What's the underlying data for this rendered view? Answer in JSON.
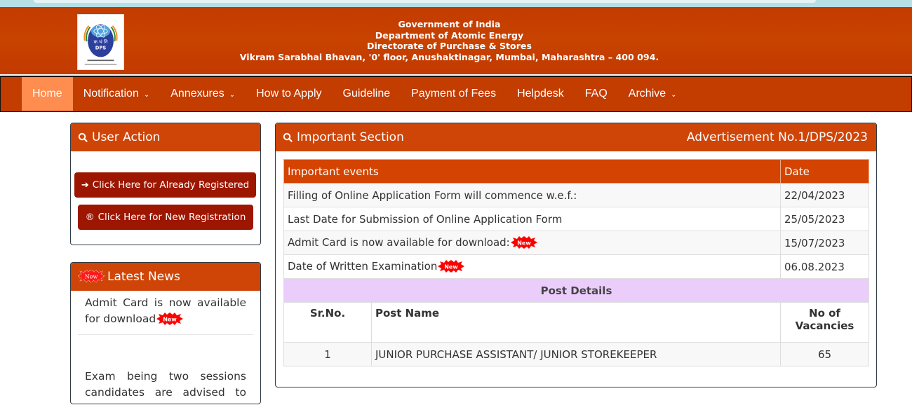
{
  "header": {
    "lines": [
      "Government of India",
      "Department of Atomic Energy",
      "Directorate of Purchase & Stores",
      "Vikram Sarabhai Bhavan, '0' floor, Anushaktinagar, Mumbai, Maharashtra – 400 094."
    ],
    "logo": {
      "text_top": "क भं नि",
      "text_bottom": "DPS"
    }
  },
  "nav": {
    "items": [
      {
        "label": "Home",
        "active": true,
        "dropdown": false
      },
      {
        "label": "Notification",
        "dropdown": true
      },
      {
        "label": "Annexures",
        "dropdown": true
      },
      {
        "label": "How to Apply",
        "dropdown": false
      },
      {
        "label": "Guideline",
        "dropdown": false
      },
      {
        "label": "Payment of Fees",
        "dropdown": false
      },
      {
        "label": "Helpdesk",
        "dropdown": false
      },
      {
        "label": "FAQ",
        "dropdown": false
      },
      {
        "label": "Archive",
        "dropdown": true
      }
    ],
    "chevron": "⌄"
  },
  "user_action": {
    "title": "User Action",
    "buttons": {
      "registered": {
        "icon": "➔",
        "label": "Click Here for Already Registered"
      },
      "new": {
        "icon": "®",
        "label": "Click Here for New Registration"
      }
    }
  },
  "latest_news": {
    "title": "Latest News",
    "items": [
      "Admit Card is now available for download",
      "Exam being two sessions candidates are advised to"
    ]
  },
  "important": {
    "title": "Important Section",
    "advertisement": "Advertisement No.1/DPS/2023",
    "events_header": {
      "event": "Important events",
      "date": "Date"
    },
    "events": [
      {
        "event": "Filling of Online Application Form will commence w.e.f.:",
        "date": "22/04/2023",
        "new": false
      },
      {
        "event": "Last Date for Submission of Online Application Form",
        "date": "25/05/2023",
        "new": false
      },
      {
        "event": "Admit Card is now available for download:",
        "date": "15/07/2023",
        "new": true
      },
      {
        "event": "Date of Written Examination",
        "date": "06.08.2023",
        "new": true
      }
    ],
    "post_details_label": "Post Details",
    "posts_header": {
      "sr": "Sr.No.",
      "name": "Post Name",
      "vacancies": "No of Vacancies"
    },
    "posts": [
      {
        "sr": "1",
        "name": "JUNIOR PURCHASE ASSISTANT/ JUNIOR STOREKEEPER",
        "vacancies": "65"
      }
    ]
  },
  "badges": {
    "new": "New"
  },
  "colors": {
    "header_bg": "#c33c00",
    "nav_active": "#ff8d4f",
    "panel_head": "#cf4507",
    "button": "#9c1600",
    "table_head": "#d44400",
    "post_details_bg": "#ebcdfb",
    "new_badge": "#ff0000"
  }
}
